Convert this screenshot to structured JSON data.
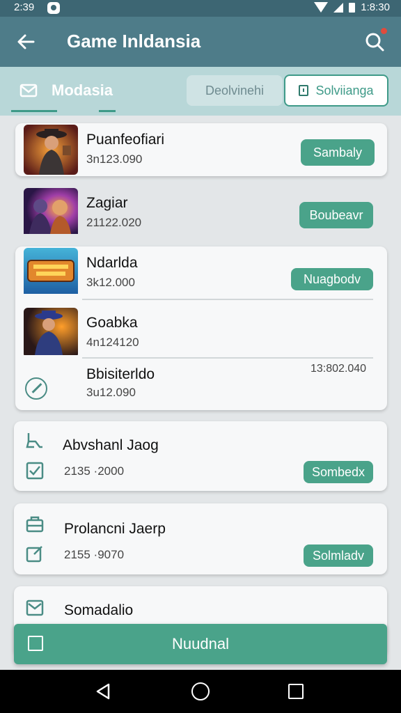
{
  "status_bar": {
    "time": "2:39",
    "right_time": "1:8:30"
  },
  "app_bar": {
    "title": "Game Inldansia"
  },
  "tabs": {
    "primary": "Modasia",
    "secondary": "Deolvinehi",
    "outlined": "Solviianga"
  },
  "games": [
    {
      "title": "Puanfeofiari",
      "subtitle": "3n123.090",
      "action": "Sambaly"
    },
    {
      "title": "Zagiar",
      "subtitle": "21122.020",
      "action": "Boubeavr"
    },
    {
      "title": "Ndarlda",
      "subtitle": "3k12.000",
      "action": "Nuagbodv"
    },
    {
      "title": "Goabka",
      "subtitle": "4n124120",
      "action": ""
    },
    {
      "title": "Bbisiterldo",
      "subtitle": "3u12.090",
      "timestamp": "13:802.040"
    }
  ],
  "list_items": [
    {
      "title": "Abvshanl Jaog",
      "subtitle": "2135 ·2000",
      "action": "Sombedx"
    },
    {
      "title": "Prolancni Jaerp",
      "subtitle": "2155 ·9070",
      "action": "Solmladv"
    },
    {
      "title": "Somadalio"
    }
  ],
  "action_bar": {
    "label": "Nuudnal"
  },
  "icons": {
    "back": "arrow-left-icon",
    "search": "search-icon",
    "mail": "mail-icon",
    "lock": "lock-icon",
    "compass": "compass-icon",
    "seat": "seat-icon",
    "check": "checkbox-icon",
    "bag": "bag-icon",
    "edit": "edit-icon"
  },
  "colors": {
    "accent": "#4aa38a",
    "app_bar": "#4e7c89",
    "tab_bar": "#b8d7d8"
  }
}
